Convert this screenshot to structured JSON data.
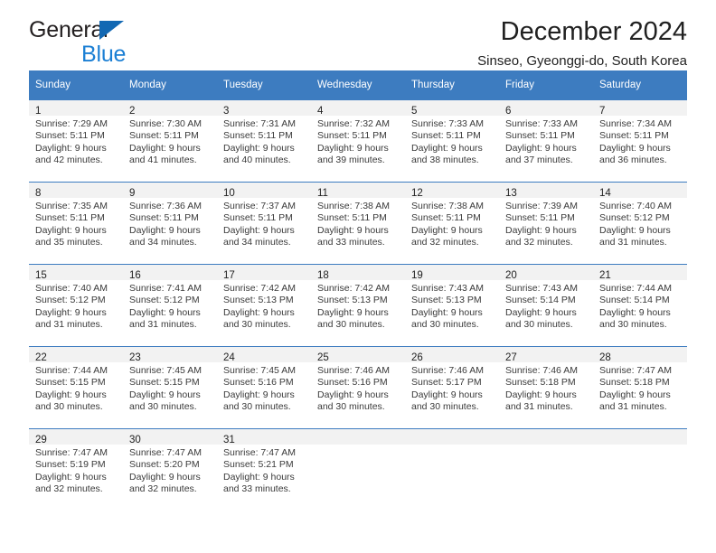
{
  "brand": {
    "name_top": "General",
    "name_bottom": "Blue",
    "triangle_color": "#1268b3",
    "blue_text_color": "#1b7fd4"
  },
  "header": {
    "title": "December 2024",
    "location": "Sinseo, Gyeonggi-do, South Korea"
  },
  "theme": {
    "header_blue": "#3d7cc0",
    "daynum_band": "#f2f2f2",
    "text": "#222222"
  },
  "weekday_headers": [
    "Sunday",
    "Monday",
    "Tuesday",
    "Wednesday",
    "Thursday",
    "Friday",
    "Saturday"
  ],
  "weeks": [
    [
      {
        "day": "1",
        "sunrise": "Sunrise: 7:29 AM",
        "sunset": "Sunset: 5:11 PM",
        "daylight": "Daylight: 9 hours and 42 minutes."
      },
      {
        "day": "2",
        "sunrise": "Sunrise: 7:30 AM",
        "sunset": "Sunset: 5:11 PM",
        "daylight": "Daylight: 9 hours and 41 minutes."
      },
      {
        "day": "3",
        "sunrise": "Sunrise: 7:31 AM",
        "sunset": "Sunset: 5:11 PM",
        "daylight": "Daylight: 9 hours and 40 minutes."
      },
      {
        "day": "4",
        "sunrise": "Sunrise: 7:32 AM",
        "sunset": "Sunset: 5:11 PM",
        "daylight": "Daylight: 9 hours and 39 minutes."
      },
      {
        "day": "5",
        "sunrise": "Sunrise: 7:33 AM",
        "sunset": "Sunset: 5:11 PM",
        "daylight": "Daylight: 9 hours and 38 minutes."
      },
      {
        "day": "6",
        "sunrise": "Sunrise: 7:33 AM",
        "sunset": "Sunset: 5:11 PM",
        "daylight": "Daylight: 9 hours and 37 minutes."
      },
      {
        "day": "7",
        "sunrise": "Sunrise: 7:34 AM",
        "sunset": "Sunset: 5:11 PM",
        "daylight": "Daylight: 9 hours and 36 minutes."
      }
    ],
    [
      {
        "day": "8",
        "sunrise": "Sunrise: 7:35 AM",
        "sunset": "Sunset: 5:11 PM",
        "daylight": "Daylight: 9 hours and 35 minutes."
      },
      {
        "day": "9",
        "sunrise": "Sunrise: 7:36 AM",
        "sunset": "Sunset: 5:11 PM",
        "daylight": "Daylight: 9 hours and 34 minutes."
      },
      {
        "day": "10",
        "sunrise": "Sunrise: 7:37 AM",
        "sunset": "Sunset: 5:11 PM",
        "daylight": "Daylight: 9 hours and 34 minutes."
      },
      {
        "day": "11",
        "sunrise": "Sunrise: 7:38 AM",
        "sunset": "Sunset: 5:11 PM",
        "daylight": "Daylight: 9 hours and 33 minutes."
      },
      {
        "day": "12",
        "sunrise": "Sunrise: 7:38 AM",
        "sunset": "Sunset: 5:11 PM",
        "daylight": "Daylight: 9 hours and 32 minutes."
      },
      {
        "day": "13",
        "sunrise": "Sunrise: 7:39 AM",
        "sunset": "Sunset: 5:11 PM",
        "daylight": "Daylight: 9 hours and 32 minutes."
      },
      {
        "day": "14",
        "sunrise": "Sunrise: 7:40 AM",
        "sunset": "Sunset: 5:12 PM",
        "daylight": "Daylight: 9 hours and 31 minutes."
      }
    ],
    [
      {
        "day": "15",
        "sunrise": "Sunrise: 7:40 AM",
        "sunset": "Sunset: 5:12 PM",
        "daylight": "Daylight: 9 hours and 31 minutes."
      },
      {
        "day": "16",
        "sunrise": "Sunrise: 7:41 AM",
        "sunset": "Sunset: 5:12 PM",
        "daylight": "Daylight: 9 hours and 31 minutes."
      },
      {
        "day": "17",
        "sunrise": "Sunrise: 7:42 AM",
        "sunset": "Sunset: 5:13 PM",
        "daylight": "Daylight: 9 hours and 30 minutes."
      },
      {
        "day": "18",
        "sunrise": "Sunrise: 7:42 AM",
        "sunset": "Sunset: 5:13 PM",
        "daylight": "Daylight: 9 hours and 30 minutes."
      },
      {
        "day": "19",
        "sunrise": "Sunrise: 7:43 AM",
        "sunset": "Sunset: 5:13 PM",
        "daylight": "Daylight: 9 hours and 30 minutes."
      },
      {
        "day": "20",
        "sunrise": "Sunrise: 7:43 AM",
        "sunset": "Sunset: 5:14 PM",
        "daylight": "Daylight: 9 hours and 30 minutes."
      },
      {
        "day": "21",
        "sunrise": "Sunrise: 7:44 AM",
        "sunset": "Sunset: 5:14 PM",
        "daylight": "Daylight: 9 hours and 30 minutes."
      }
    ],
    [
      {
        "day": "22",
        "sunrise": "Sunrise: 7:44 AM",
        "sunset": "Sunset: 5:15 PM",
        "daylight": "Daylight: 9 hours and 30 minutes."
      },
      {
        "day": "23",
        "sunrise": "Sunrise: 7:45 AM",
        "sunset": "Sunset: 5:15 PM",
        "daylight": "Daylight: 9 hours and 30 minutes."
      },
      {
        "day": "24",
        "sunrise": "Sunrise: 7:45 AM",
        "sunset": "Sunset: 5:16 PM",
        "daylight": "Daylight: 9 hours and 30 minutes."
      },
      {
        "day": "25",
        "sunrise": "Sunrise: 7:46 AM",
        "sunset": "Sunset: 5:16 PM",
        "daylight": "Daylight: 9 hours and 30 minutes."
      },
      {
        "day": "26",
        "sunrise": "Sunrise: 7:46 AM",
        "sunset": "Sunset: 5:17 PM",
        "daylight": "Daylight: 9 hours and 30 minutes."
      },
      {
        "day": "27",
        "sunrise": "Sunrise: 7:46 AM",
        "sunset": "Sunset: 5:18 PM",
        "daylight": "Daylight: 9 hours and 31 minutes."
      },
      {
        "day": "28",
        "sunrise": "Sunrise: 7:47 AM",
        "sunset": "Sunset: 5:18 PM",
        "daylight": "Daylight: 9 hours and 31 minutes."
      }
    ],
    [
      {
        "day": "29",
        "sunrise": "Sunrise: 7:47 AM",
        "sunset": "Sunset: 5:19 PM",
        "daylight": "Daylight: 9 hours and 32 minutes."
      },
      {
        "day": "30",
        "sunrise": "Sunrise: 7:47 AM",
        "sunset": "Sunset: 5:20 PM",
        "daylight": "Daylight: 9 hours and 32 minutes."
      },
      {
        "day": "31",
        "sunrise": "Sunrise: 7:47 AM",
        "sunset": "Sunset: 5:21 PM",
        "daylight": "Daylight: 9 hours and 33 minutes."
      },
      {
        "day": "",
        "sunrise": "",
        "sunset": "",
        "daylight": ""
      },
      {
        "day": "",
        "sunrise": "",
        "sunset": "",
        "daylight": ""
      },
      {
        "day": "",
        "sunrise": "",
        "sunset": "",
        "daylight": ""
      },
      {
        "day": "",
        "sunrise": "",
        "sunset": "",
        "daylight": ""
      }
    ]
  ]
}
